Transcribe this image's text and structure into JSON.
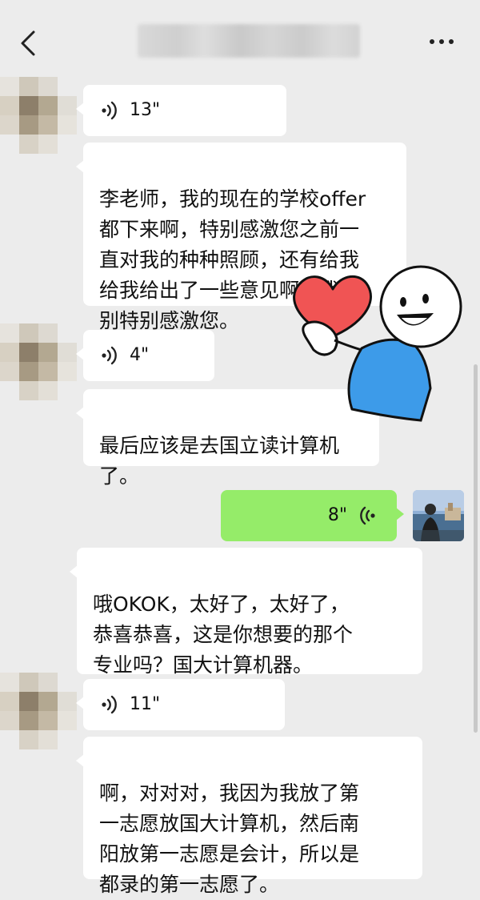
{
  "header": {
    "title": "",
    "back_icon": "chevron-left-icon",
    "more_icon": "more-dots-icon"
  },
  "messages": [
    {
      "side": "in",
      "type": "voice",
      "duration": "13\""
    },
    {
      "side": "in",
      "type": "text",
      "text": "李老师，我的现在的学校offer\n都下来啊，特别感激您之前一\n直对我的种种照顾，还有给我\n给我给出了一些意见啊，我特\n别特别感激您。"
    },
    {
      "side": "in",
      "type": "voice",
      "duration": "4\""
    },
    {
      "side": "in",
      "type": "text",
      "text": "最后应该是去国立读计算机\n了。"
    },
    {
      "side": "out",
      "type": "voice",
      "duration": "8\""
    },
    {
      "side": "in",
      "type": "text",
      "text": "哦OKOK，太好了，太好了，\n恭喜恭喜，这是你想要的那个\n专业吗？国大计算机器。"
    },
    {
      "side": "in",
      "type": "voice",
      "duration": "11\""
    },
    {
      "side": "in",
      "type": "text",
      "text": "啊，对对对，我因为我放了第\n一志愿放国大计算机，然后南\n阳放第一志愿是会计，所以是\n都录的第一志愿了。"
    }
  ],
  "sticker": {
    "icon": "heart-character-sticker"
  },
  "colors": {
    "background": "#ececec",
    "bubble_in": "#ffffff",
    "bubble_out": "#95ec69",
    "heart": "#f05454",
    "shirt": "#3d9be9"
  }
}
